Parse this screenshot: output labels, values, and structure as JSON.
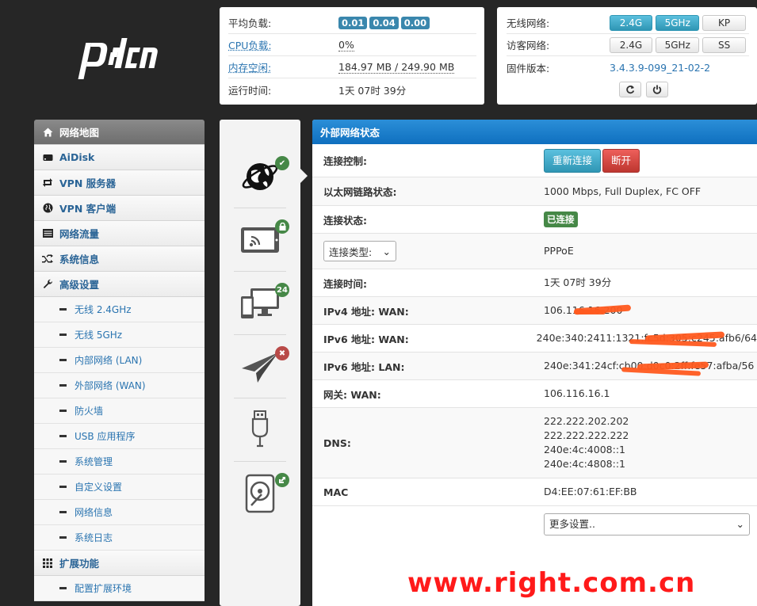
{
  "logo": {
    "text": "pdcn"
  },
  "system": {
    "load": {
      "label": "平均负载:",
      "badges": [
        "0.01",
        "0.04",
        "0.00"
      ]
    },
    "cpu": {
      "label": "CPU负载:",
      "value": "0%"
    },
    "memory": {
      "label": "内存空闲:",
      "value": "184.97 MB / 249.90 MB"
    },
    "uptime": {
      "label": "运行时间:",
      "value": "1天 07时 39分"
    }
  },
  "wireless": {
    "wifi": {
      "label": "无线网络:",
      "buttons": [
        "2.4G",
        "5GHz",
        "KP"
      ]
    },
    "guest": {
      "label": "访客网络:",
      "buttons": [
        "2.4G",
        "5GHz",
        "SS"
      ]
    },
    "firmware": {
      "label": "固件版本:",
      "value": "3.4.3.9-099_21-02-2"
    },
    "icons": [
      "refresh-icon",
      "power-icon"
    ]
  },
  "sidebar": {
    "items": [
      {
        "label": "网络地图",
        "icon": "home-icon",
        "active": true
      },
      {
        "label": "AiDisk",
        "icon": "disk-icon"
      },
      {
        "label": "VPN 服务器",
        "icon": "retweet-icon"
      },
      {
        "label": "VPN 客户端",
        "icon": "globe-icon"
      },
      {
        "label": "网络流量",
        "icon": "list-icon"
      },
      {
        "label": "系统信息",
        "icon": "random-icon"
      },
      {
        "label": "高级设置",
        "icon": "wrench-icon"
      }
    ],
    "sub_items": [
      "无线 2.4GHz",
      "无线 5GHz",
      "内部网络 (LAN)",
      "外部网络 (WAN)",
      "防火墙",
      "USB 应用程序",
      "系统管理",
      "自定义设置",
      "网络信息",
      "系统日志"
    ],
    "ext": {
      "label": "扩展功能",
      "icon": "grid-icon"
    },
    "ext_sub": [
      "配置扩展环境"
    ]
  },
  "icon_column": {
    "badge_count": "24",
    "items": [
      "internet-globe-icon",
      "wireless-device-icon",
      "clients-icon",
      "paper-plane-icon",
      "usb-icon",
      "hard-disk-icon"
    ]
  },
  "wan": {
    "title": "外部网络状态",
    "control": {
      "label": "连接控制:",
      "reconnect": "重新连接",
      "disconnect": "断开"
    },
    "ethernet": {
      "label": "以太网链路状态:",
      "value": "1000 Mbps, Full Duplex, FC OFF"
    },
    "status": {
      "label": "连接状态:",
      "value": "已连接"
    },
    "type": {
      "select_label": "连接类型:",
      "value": "PPPoE"
    },
    "conn_time": {
      "label": "连接时间:",
      "value": "1天 07时 39分"
    },
    "ipv4": {
      "label": "IPv4 地址: WAN:",
      "value": "106.116.16.200"
    },
    "ipv6_wan": {
      "label": "IPv6 地址: WAN:",
      "value": "240e:340:2411:1321:fc5d:305:c245:afb6/64"
    },
    "ipv6_lan": {
      "label": "IPv6 地址: LAN:",
      "value": "240e:341:24cf:cb00:d0c0:2ff:fe57:afba/56"
    },
    "gateway": {
      "label": "网关: WAN:",
      "value": "106.116.16.1"
    },
    "dns": {
      "label": "DNS:",
      "values": [
        "222.222.202.202",
        "222.222.222.222",
        "240e:4c:4008::1",
        "240e:4c:4808::1"
      ]
    },
    "mac": {
      "label": "MAC",
      "value": "D4:EE:07:61:EF:BB"
    },
    "more": {
      "label": "更多设置.."
    }
  },
  "watermark": "www.right.com.cn",
  "colors": {
    "accent": "#2b8fd8",
    "info": "#3a87ad",
    "success": "#468847",
    "danger": "#bd362f"
  }
}
